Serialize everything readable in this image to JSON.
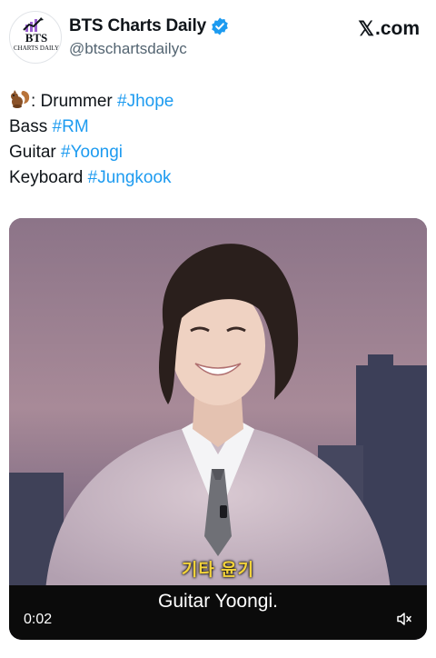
{
  "author": {
    "avatar_text_top": "BTS",
    "avatar_text_bottom": "CHARTS DAILY",
    "display_name": "BTS Charts Daily",
    "handle": "@btschartsdailyc",
    "verified": true
  },
  "source": {
    "logo": "𝕏",
    "domain": ".com"
  },
  "tweet": {
    "lines": [
      {
        "icon": "squirrel-icon",
        "prefix": ": Drummer ",
        "hashtag": "#Jhope"
      },
      {
        "prefix": "Bass ",
        "hashtag": "#RM"
      },
      {
        "prefix": "Guitar ",
        "hashtag": "#Yoongi"
      },
      {
        "prefix": "Keyboard ",
        "hashtag": "#Jungkook"
      }
    ]
  },
  "video": {
    "subtitle_korean": "기타 윤기",
    "subtitle_english": "Guitar Yoongi.",
    "time": "0:02",
    "mute_icon": "mute-icon"
  },
  "colors": {
    "hashtag": "#1d9bf0",
    "verified": "#1d9bf0",
    "subtitle_korean": "#f3d33a",
    "handle": "#536471"
  }
}
